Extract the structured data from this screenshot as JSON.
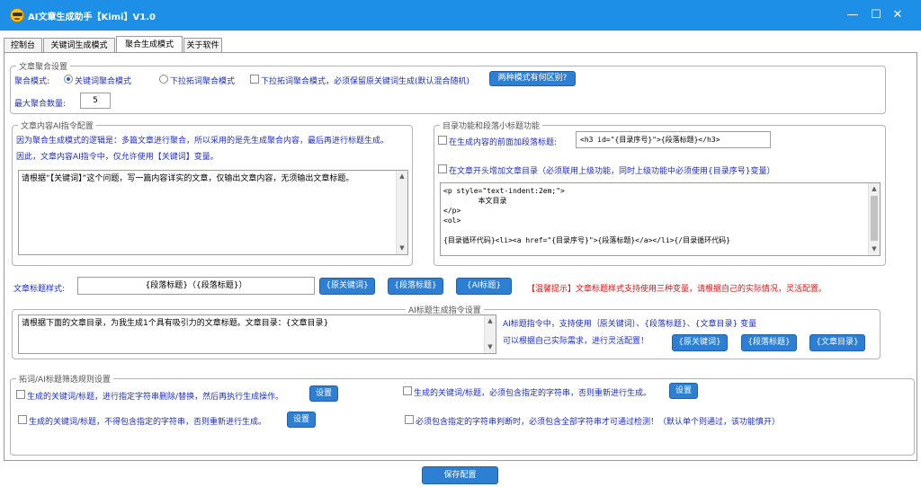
{
  "window": {
    "title": "AI文章生成助手【Kimi】V1.0",
    "min_glyph": "—",
    "max_glyph": "☐",
    "close_glyph": "✕"
  },
  "tabs": [
    "控制台",
    "关键词生成模式",
    "聚合生成模式",
    "关于软件"
  ],
  "active_tab": 2,
  "article_aggregation": {
    "legend": "文章聚合设置",
    "mode_label": "聚合模式:",
    "options": [
      "关键词聚合模式",
      "下拉拓词聚合模式",
      "下拉拓词聚合模式，必须保留原关键词生成(默认混合随机)"
    ],
    "selected": 0,
    "diff_button": "两种模式有何区别?",
    "max_label": "最大聚合数量:",
    "max_value": "5"
  },
  "ai_instruction": {
    "legend": "文章内容AI指令配置",
    "note1": "因为聚合生成模式的逻辑是：多篇文章进行聚合，所以采用的是先生成聚合内容，最后再进行标题生成。",
    "note2": "因此，文章内容AI指令中，仅允许使用【关键词】变量。",
    "prompt": "请根据“【关键词】”这个问题，写一篇内容详实的文章，仅输出文章内容，无须输出文章标题。"
  },
  "toc": {
    "legend": "目录功能和段落小标题功能",
    "subheading_label": "在生成内容的前面加段落标题:",
    "subheading_value": "<h3 id=\"{目录序号}\">{段落标题}</h3>",
    "toc_label": "在文章开头增加文章目录（必须联用上级功能，同时上级功能中必须使用{目录序号}变量）",
    "toc_template": "<p style=\"text-indent:2em;\">\n        本文目录\n</p>\n<ol>\n\n{目录循环代码}<li><a href=\"{目录序号}\">{段落标题}</a></li>{/目录循环代码}\n\n</ol>"
  },
  "title_style": {
    "label": "文章标题样式:",
    "value": "{段落标题}（{段落标题}）",
    "buttons": [
      "{原关键词}",
      "{段落标题}",
      "{AI标题}"
    ],
    "tip": "【温馨提示】文章标题样式支持使用三种变量，请根据自己的实际情况，灵活配置。"
  },
  "ai_title": {
    "legend": "AI标题生成指令设置",
    "prompt": "请根据下面的文章目录，为我生成1个具有吸引力的文章标题。文章目录：{文章目录}",
    "desc1": "AI标题指令中，支持使用｛原关键词｝、{段落标题}、{文章目录} 变量",
    "desc2": "可以根据自己实际需求，进行灵活配置！",
    "buttons": [
      "{原关键词}",
      "{段落标题}",
      "{文章目录}"
    ]
  },
  "filter": {
    "legend": "拓词/AI标题筛选规则设置",
    "rule1": "生成的关键词/标题，进行指定字符串删除/替换，然后再执行生成操作。",
    "rule2": "生成的关键词/标题，必须包含指定的字符串，否则重新进行生成。",
    "rule3": "生成的关键词/标题，不得包含指定的字符串，否则重新进行生成。",
    "rule4": "必须包含指定的字符串判断时，必须包含全部字符串才可通过检测！（默认单个则通过，该功能慎开）",
    "setting_button": "设置"
  },
  "save_button": "保存配置"
}
